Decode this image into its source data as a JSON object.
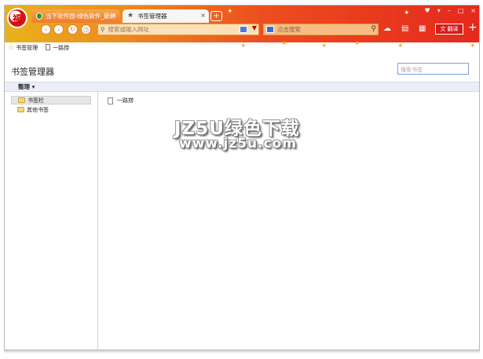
{
  "browser": {
    "logo_glyph": "福",
    "tabs": [
      {
        "label": "当下软件园-绿色软件_最新",
        "active": false
      },
      {
        "label": "书签管理器",
        "active": true
      }
    ],
    "new_tab_glyph": "+",
    "window_controls": [
      "♥",
      "▾",
      "–",
      "□",
      "×"
    ],
    "address": {
      "placeholder": "搜索或输入网址"
    },
    "search": {
      "placeholder": "点击搜索"
    },
    "translate_label": "翻译",
    "brand_color": "#e5291d"
  },
  "bookmarks_bar": {
    "items": [
      {
        "label": "书签管理",
        "icon": "star-icon"
      },
      {
        "label": "一路捞",
        "icon": "doc-icon"
      }
    ]
  },
  "manager": {
    "title": "书签管理器",
    "search_placeholder": "搜索书签",
    "organize_label": "整理 ▾",
    "folders": [
      {
        "label": "书签栏",
        "selected": true
      },
      {
        "label": "其他书签",
        "selected": false
      }
    ],
    "items": [
      {
        "label": "一路捞"
      }
    ]
  },
  "watermark": {
    "line1": "JZ5U绿色下载",
    "line2": "www.jz5u.com"
  }
}
